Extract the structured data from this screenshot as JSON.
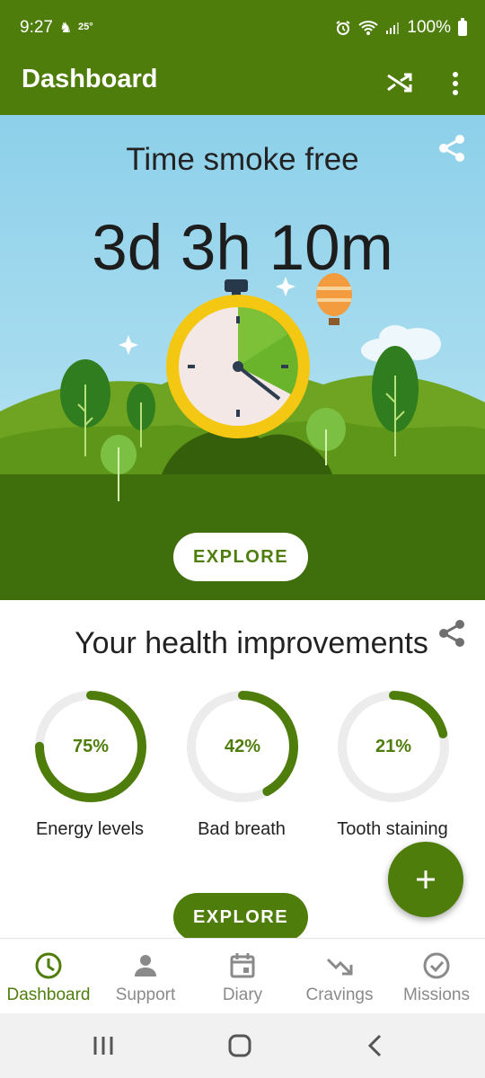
{
  "status_bar": {
    "time": "9:27",
    "temperature": "25°",
    "battery": "100%"
  },
  "app_bar": {
    "title": "Dashboard"
  },
  "hero": {
    "title": "Time smoke free",
    "elapsed": "3d 3h 10m",
    "explore_label": "EXPLORE"
  },
  "health": {
    "title": "Your health improvements",
    "items": [
      {
        "percent_label": "75%",
        "progress": 0.75,
        "label": "Energy levels"
      },
      {
        "percent_label": "42%",
        "progress": 0.42,
        "label": "Bad breath"
      },
      {
        "percent_label": "21%",
        "progress": 0.21,
        "label": "Tooth staining"
      }
    ],
    "explore_label": "EXPLORE"
  },
  "bottom_nav": [
    {
      "label": "Dashboard",
      "icon": "clock-icon",
      "active": true
    },
    {
      "label": "Support",
      "icon": "person-icon",
      "active": false
    },
    {
      "label": "Diary",
      "icon": "calendar-icon",
      "active": false
    },
    {
      "label": "Cravings",
      "icon": "trending-down-icon",
      "active": false
    },
    {
      "label": "Missions",
      "icon": "check-circle-icon",
      "active": false
    }
  ],
  "colors": {
    "primary": "#4f7d0c",
    "ring_track": "#ececec",
    "inactive": "#8a8a8a"
  }
}
